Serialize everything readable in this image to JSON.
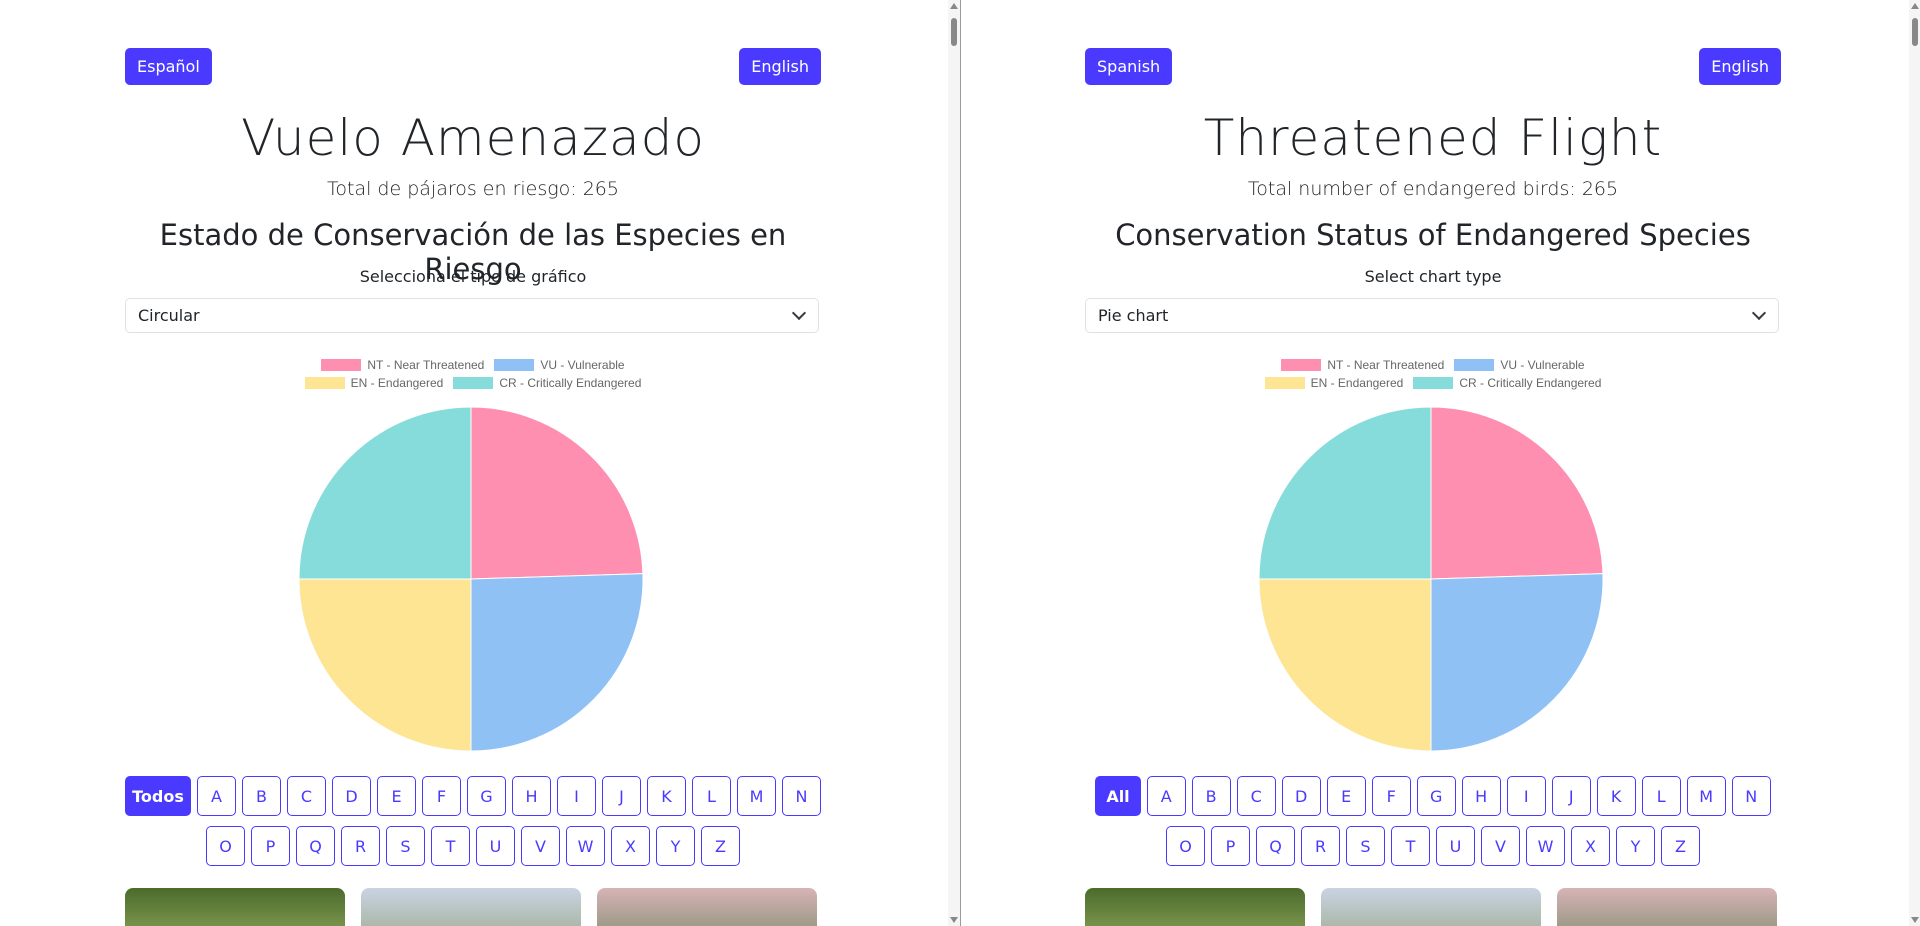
{
  "left": {
    "lang_left": "Español",
    "lang_right": "English",
    "title": "Vuelo Amenazado",
    "total": "Total de pájaros en riesgo: 265",
    "subtitle": "Estado de Conservación de las Especies en Riesgo",
    "select_label": "Selecciona el tipo de gráfico",
    "select_value": "Circular",
    "all_label": "Todos"
  },
  "right": {
    "lang_left": "Spanish",
    "lang_right": "English",
    "title": "Threatened Flight",
    "total": "Total number of endangered birds: 265",
    "subtitle": "Conservation Status of Endangered Species",
    "select_label": "Select chart type",
    "select_value": "Pie chart",
    "all_label": "All"
  },
  "letters_row1": [
    "A",
    "B",
    "C",
    "D",
    "E",
    "F",
    "G",
    "H",
    "I",
    "J",
    "K",
    "L",
    "M",
    "N"
  ],
  "letters_row2": [
    "O",
    "P",
    "Q",
    "R",
    "S",
    "T",
    "U",
    "V",
    "W",
    "X",
    "Y",
    "Z"
  ],
  "colors": {
    "accent": "#4a3aff",
    "nt": "#ff8fb1",
    "vu": "#8fc1f5",
    "en": "#fde594",
    "cr": "#86dcda"
  },
  "chart_data": {
    "type": "pie",
    "categories": [
      "NT - Near Threatened",
      "VU - Vulnerable",
      "EN - Endangered",
      "CR - Critically Endangered"
    ],
    "values": [
      24.5,
      25.5,
      25.0,
      25.0
    ],
    "legend": "top"
  }
}
